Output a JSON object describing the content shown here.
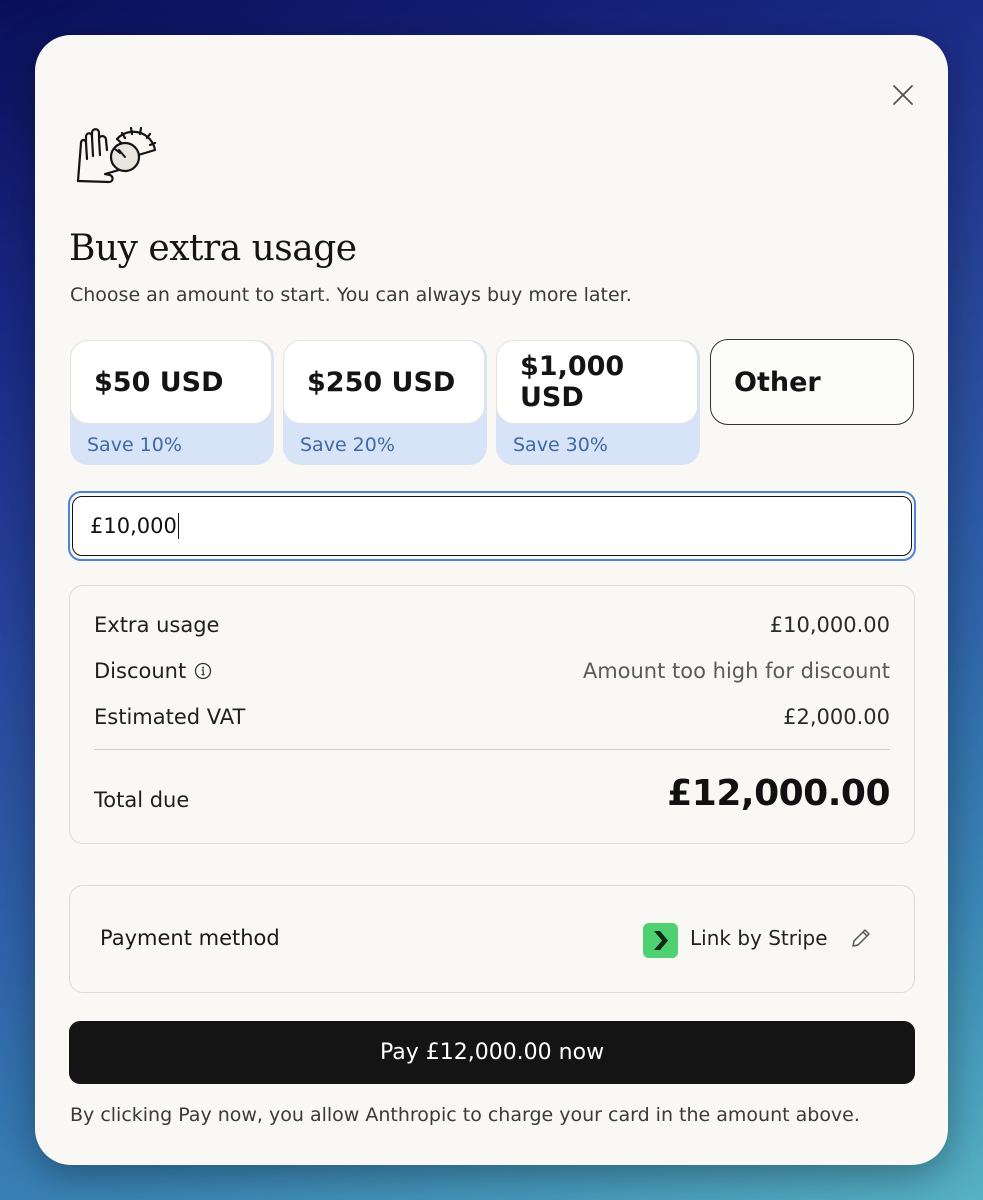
{
  "modal": {
    "title": "Buy extra usage",
    "subtitle": "Choose an amount to start. You can always buy more later."
  },
  "icons": {
    "close": "close-icon",
    "logo": "hand-with-dial-illustration",
    "info": "info-icon",
    "edit": "pencil-icon",
    "link": "link-by-stripe-logo"
  },
  "options": [
    {
      "label": "$50 USD",
      "save": "Save 10%"
    },
    {
      "label": "$250 USD",
      "save": "Save 20%"
    },
    {
      "label": "$1,000 USD",
      "save": "Save 30%"
    },
    {
      "label": "Other"
    }
  ],
  "amount_input": {
    "value": "£10,000",
    "focused": true
  },
  "summary": {
    "extra_usage_label": "Extra usage",
    "extra_usage_value": "£10,000.00",
    "discount_label": "Discount",
    "discount_value": "Amount too high for discount",
    "vat_label": "Estimated VAT",
    "vat_value": "£2,000.00",
    "total_label": "Total due",
    "total_value": "£12,000.00"
  },
  "payment": {
    "label": "Payment method",
    "method": "Link by Stripe"
  },
  "pay_button": "Pay £12,000.00 now",
  "disclaimer": "By clicking Pay now, you allow Anthropic to charge your card in the amount above.",
  "colors": {
    "accent_blue": "#4e84d6",
    "save_band": "#d7e4f7",
    "save_text": "#3d6aa7",
    "link_green": "#4fd071",
    "button_dark": "#141414",
    "modal_bg": "#f9f8f4"
  }
}
